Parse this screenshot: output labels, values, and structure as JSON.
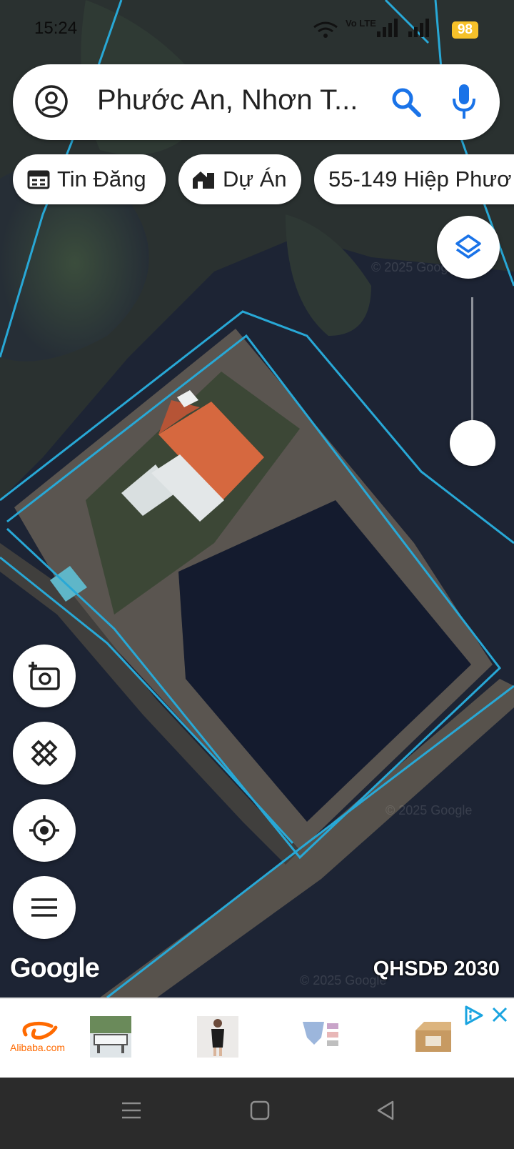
{
  "status_bar": {
    "time": "15:24",
    "carrier": "Vo LTE",
    "battery": "98"
  },
  "search": {
    "query": "Phước An, Nhơn T..."
  },
  "chips": [
    {
      "label": "Tin Đăng",
      "icon": "calendar-icon"
    },
    {
      "label": "Dự Án",
      "icon": "house-icon"
    },
    {
      "label": "55-149 Hiệp Phươ",
      "icon": ""
    }
  ],
  "map": {
    "watermark": "© 2025 Google",
    "brand": "Google",
    "layer_label": "QHSDĐ 2030",
    "controls": [
      "layers-icon",
      "add-photo-icon",
      "measure-icon",
      "my-location-icon",
      "menu-icon"
    ]
  },
  "ad": {
    "advertiser": "Alibaba.com",
    "colors": {
      "alibaba": "#ff6a00",
      "adchoices": "#1aa4e0"
    }
  },
  "colors": {
    "parcel_line": "#28a8d6",
    "roof": "#d6683f",
    "accent": "#1a73e8",
    "battery": "#f6c12a"
  }
}
